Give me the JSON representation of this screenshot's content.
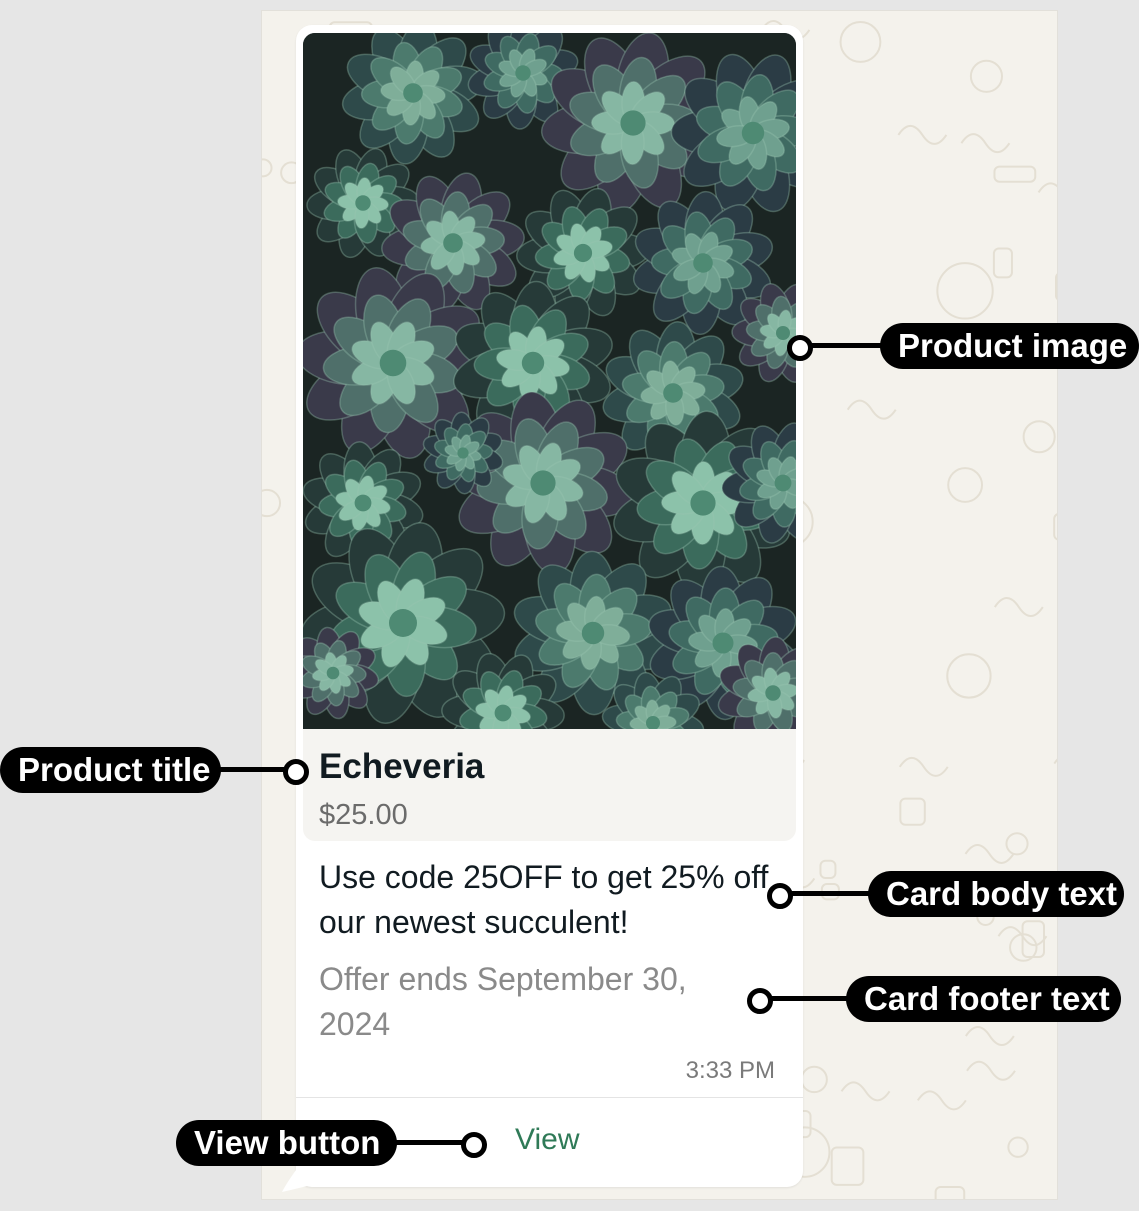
{
  "product": {
    "title": "Echeveria",
    "price": "$25.00"
  },
  "message": {
    "body": "Use code 25OFF to get 25% off our newest succulent!",
    "footer": "Offer ends September 30, 2024",
    "time": "3:33 PM"
  },
  "button": {
    "label": "View"
  },
  "annotations": {
    "product_image": "Product image",
    "product_title": "Product title",
    "card_body": "Card body text",
    "card_footer": "Card footer text",
    "view_button": "View button"
  },
  "colors": {
    "chat_background": "#f4f2ec",
    "bubble": "#ffffff",
    "product_box": "#f5f4f1",
    "button_text": "#2f7a57",
    "callout": "#000000"
  }
}
